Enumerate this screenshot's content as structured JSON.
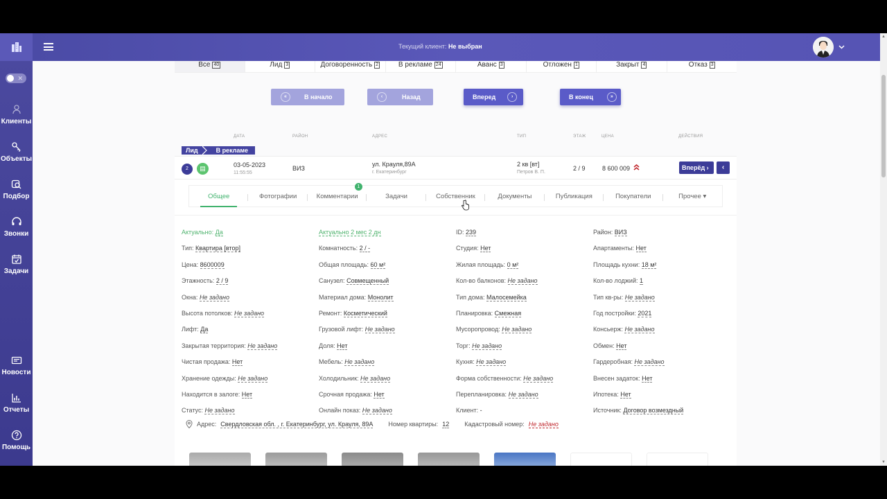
{
  "topbar": {
    "client_label": "Текущий клиент:",
    "client_value": "Не выбран"
  },
  "sidebar": {
    "items": [
      {
        "label": "Клиенты",
        "icon": "user-icon"
      },
      {
        "label": "Объекты",
        "icon": "key-icon"
      },
      {
        "label": "Подбор",
        "icon": "selection-icon"
      },
      {
        "label": "Звонки",
        "icon": "headset-icon"
      },
      {
        "label": "Задачи",
        "icon": "calendar-icon"
      },
      {
        "label": "Новости",
        "icon": "news-icon"
      },
      {
        "label": "Отчеты",
        "icon": "chart-icon"
      },
      {
        "label": "Помощь",
        "icon": "help-icon"
      }
    ]
  },
  "status_tabs": [
    {
      "label": "Все",
      "count": "40"
    },
    {
      "label": "Лид",
      "count": "3"
    },
    {
      "label": "Договоренность",
      "count": "2"
    },
    {
      "label": "В рекламе",
      "count": "24"
    },
    {
      "label": "Аванс",
      "count": "3"
    },
    {
      "label": "Отложен",
      "count": "1"
    },
    {
      "label": "Закрыт",
      "count": "4"
    },
    {
      "label": "Отказ",
      "count": "3"
    }
  ],
  "pager": {
    "first": "В начало",
    "prev": "Назад",
    "next": "Вперед",
    "last": "В конец"
  },
  "columns": {
    "date": "ДАТА",
    "district": "РАЙОН",
    "address": "АДРЕС",
    "type": "ТИП",
    "floor": "ЭТАЖ",
    "price": "ЦЕНА",
    "actions": "ДЕЙСТВИЯ"
  },
  "breadcrumb": {
    "stage1": "Лид",
    "stage2": "В рекламе"
  },
  "row": {
    "num": "2",
    "date": "03-05-2023",
    "time": "11:55:55",
    "district": "ВИЗ",
    "address": "ул. Крауля,89А",
    "city": "г. Екатеринбург",
    "type": "2 кв [вт]",
    "agent": "Петров В. П.",
    "floor": "2 / 9",
    "price": "8 600 009",
    "forward_label": "Вперёд"
  },
  "detail_tabs": [
    {
      "label": "Общее"
    },
    {
      "label": "Фотографии"
    },
    {
      "label": "Комментарии",
      "badge": "1"
    },
    {
      "label": "Задачи"
    },
    {
      "label": "Собственник"
    },
    {
      "label": "Документы"
    },
    {
      "label": "Публикация"
    },
    {
      "label": "Покупатели"
    },
    {
      "label": "Прочее ▾"
    }
  ],
  "props": [
    {
      "k": "Актуально:",
      "v": "Да",
      "green": true
    },
    {
      "k": "",
      "v": "Актуально 2 мес 2 дн",
      "green": true
    },
    {
      "k": "ID:",
      "v": "239"
    },
    {
      "k": "Район:",
      "v": "ВИЗ"
    },
    {
      "k": "Тип:",
      "v": "Квартира [втор]"
    },
    {
      "k": "Комнатность:",
      "v": "2 / -"
    },
    {
      "k": "Студия:",
      "v": "Нет"
    },
    {
      "k": "Апартаменты:",
      "v": "Нет"
    },
    {
      "k": "Цена:",
      "v": "8600009"
    },
    {
      "k": "Общая площадь:",
      "v": "60 м²"
    },
    {
      "k": "Жилая площадь:",
      "v": "0 м²"
    },
    {
      "k": "Площадь кухни:",
      "v": "18 м²"
    },
    {
      "k": "Этажность:",
      "v": "2 / 9"
    },
    {
      "k": "Санузел:",
      "v": "Совмещенный"
    },
    {
      "k": "Кол-во балконов:",
      "v": "Не задано",
      "italic": true
    },
    {
      "k": "Кол-во лоджий:",
      "v": "1"
    },
    {
      "k": "Окна:",
      "v": "Не задано",
      "italic": true
    },
    {
      "k": "Материал дома:",
      "v": "Монолит"
    },
    {
      "k": "Тип дома:",
      "v": "Малосемейка"
    },
    {
      "k": "Тип кв-ры:",
      "v": "Не задано",
      "italic": true
    },
    {
      "k": "Высота потолков:",
      "v": "Не задано",
      "italic": true
    },
    {
      "k": "Ремонт:",
      "v": "Косметический"
    },
    {
      "k": "Планировка:",
      "v": "Смежная"
    },
    {
      "k": "Год постройки:",
      "v": "2021"
    },
    {
      "k": "Лифт:",
      "v": "Да"
    },
    {
      "k": "Грузовой лифт:",
      "v": "Не задано",
      "italic": true
    },
    {
      "k": "Мусоропровод:",
      "v": "Не задано",
      "italic": true
    },
    {
      "k": "Консьерж:",
      "v": "Не задано",
      "italic": true
    },
    {
      "k": "Закрытая территория:",
      "v": "Не задано",
      "italic": true
    },
    {
      "k": "Доля:",
      "v": "Нет"
    },
    {
      "k": "Торг:",
      "v": "Не задано",
      "italic": true
    },
    {
      "k": "Обмен:",
      "v": "Нет"
    },
    {
      "k": "Чистая продажа:",
      "v": "Нет"
    },
    {
      "k": "Мебель:",
      "v": "Не задано",
      "italic": true
    },
    {
      "k": "Кухня:",
      "v": "Не задано",
      "italic": true
    },
    {
      "k": "Гардеробная:",
      "v": "Не задано",
      "italic": true
    },
    {
      "k": "Хранение одежды:",
      "v": "Не задано",
      "italic": true
    },
    {
      "k": "Холодильник:",
      "v": "Не задано",
      "italic": true
    },
    {
      "k": "Форма собственности:",
      "v": "Не задано",
      "italic": true
    },
    {
      "k": "Внесен задаток:",
      "v": "Нет"
    },
    {
      "k": "Находится в залоге:",
      "v": "Нет"
    },
    {
      "k": "Срочная продажа:",
      "v": "Нет"
    },
    {
      "k": "Перепланировка:",
      "v": "Не задано",
      "italic": true
    },
    {
      "k": "Ипотека:",
      "v": "Нет"
    },
    {
      "k": "Статус:",
      "v": "Не задано",
      "italic": true
    },
    {
      "k": "Онлайн показ:",
      "v": "Не задано",
      "italic": true
    },
    {
      "k": "Клиент:",
      "v": "-",
      "plain": true
    },
    {
      "k": "Источник:",
      "v": "Договор возмездный"
    }
  ],
  "address_line": {
    "label": "Адрес:",
    "value": "Свердловская обл. , г. Екатеринбург, ул. Крауля, 89А",
    "apt_label": "Номер квартиры:",
    "apt_value": "12",
    "cadastral_label": "Кадастровый номер:",
    "cadastral_value": "Не задано"
  }
}
